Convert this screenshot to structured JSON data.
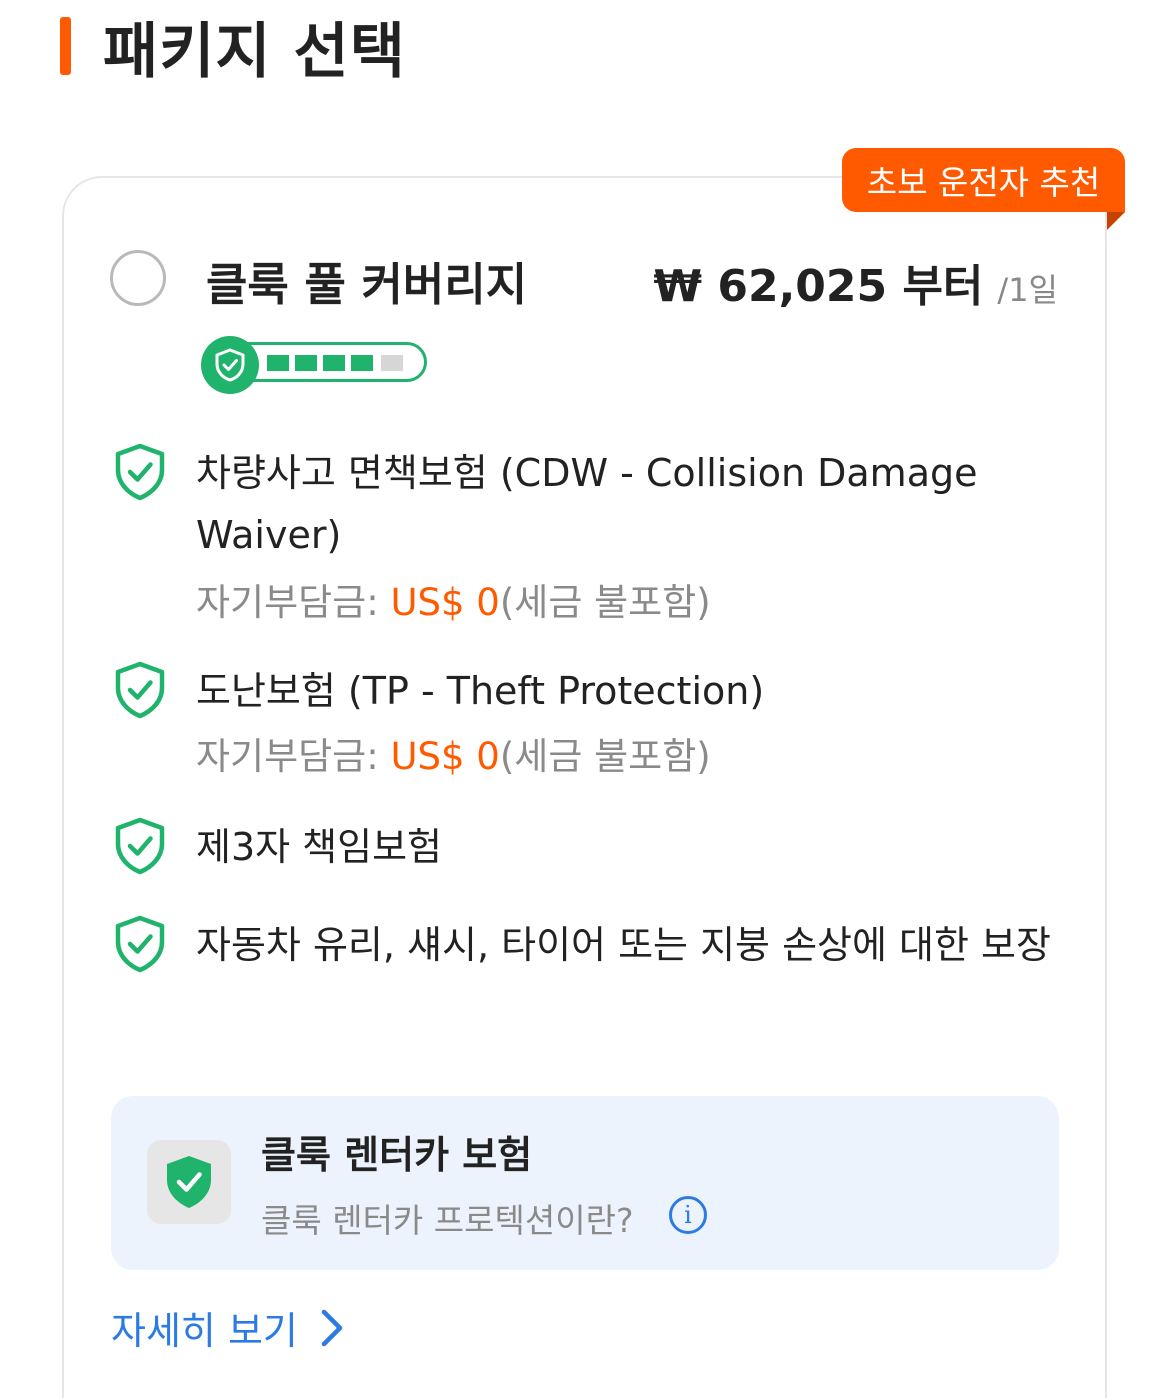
{
  "section": {
    "title": "패키지 선택"
  },
  "package": {
    "badge": "초보 운전자 추천",
    "name": "클룩 풀 커버리지",
    "price": "₩ 62,025 부터",
    "per_day": "/1일",
    "protection_level": 0.8
  },
  "coverages": [
    {
      "title": "차량사고 면책보험 (CDW - Collision Damage Waiver)",
      "deductible_label": "자기부담금:",
      "deductible_value": "US$ 0",
      "deductible_note": "(세금 불포함)"
    },
    {
      "title": "도난보험 (TP - Theft Protection)",
      "deductible_label": "자기부담금:",
      "deductible_value": "US$ 0",
      "deductible_note": "(세금 불포함)"
    },
    {
      "title": "제3자 책임보험"
    },
    {
      "title": "자동차 유리, 섀시, 타이어 또는 지붕 손상에 대한 보장"
    }
  ],
  "insurance_box": {
    "title": "클룩 렌터카 보험",
    "question": "클룩 렌터카 프로텍션이란?",
    "info_icon": "info-icon"
  },
  "details_link": "자세히 보기",
  "colors": {
    "accent": "#ff5a00",
    "green": "#1fb36b",
    "link": "#2c7be5"
  }
}
